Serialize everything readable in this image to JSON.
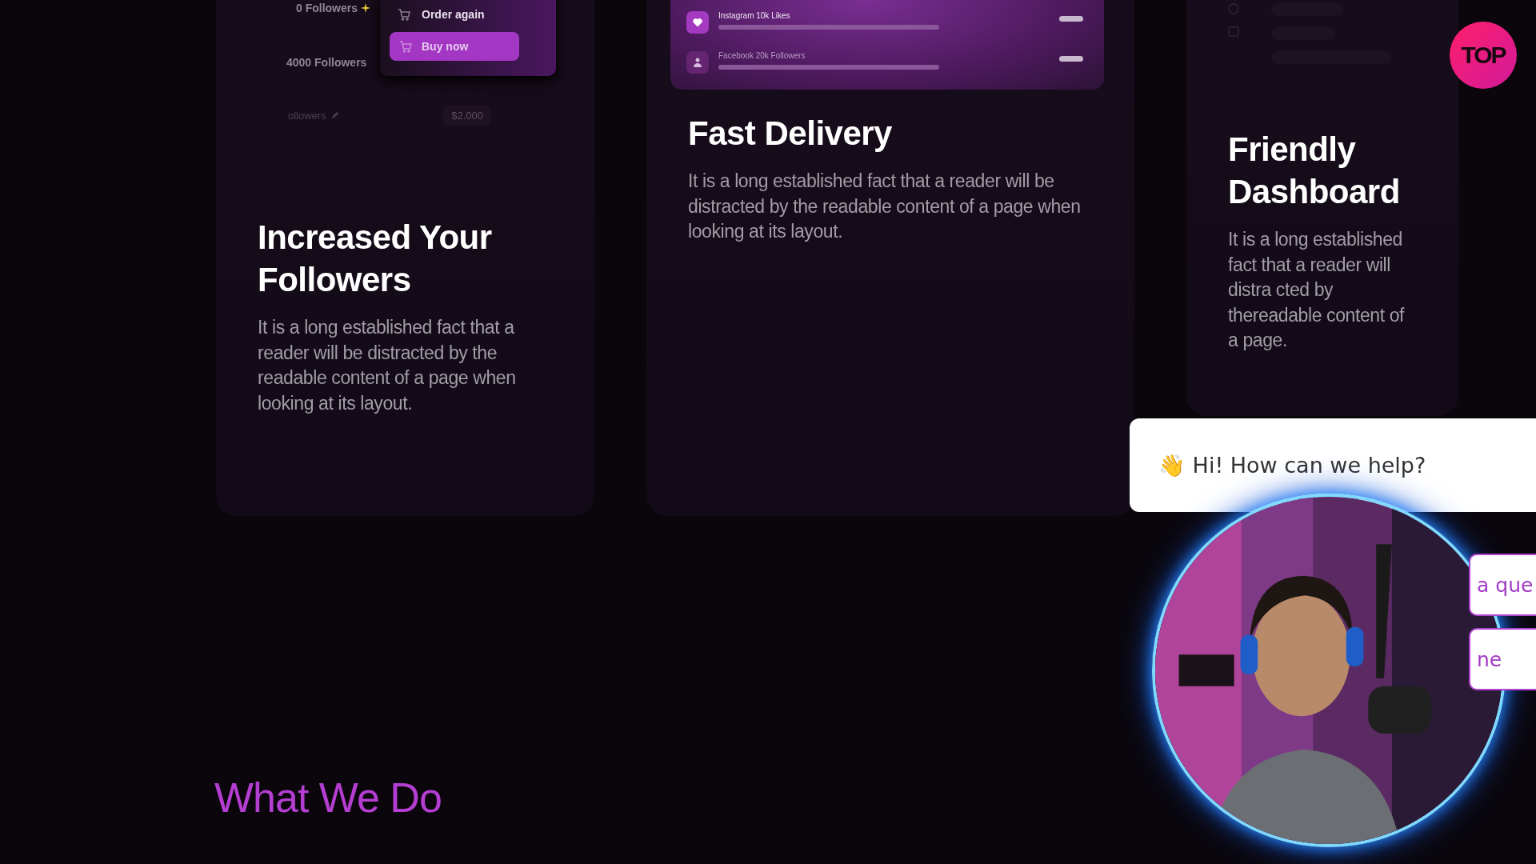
{
  "logo": {
    "text": "TOP"
  },
  "cards": [
    {
      "kind": "orders",
      "title": "Increased Your Followers",
      "body": "It is a long established fact that a reader will be distracted by the readable content of a page when looking at its layout.",
      "mockup": {
        "rows": [
          "0 Followers",
          "4000 Followers"
        ],
        "last_row": {
          "label": "ollowers",
          "price": "$2.000"
        },
        "menu": {
          "item": "Order again",
          "button": "Buy now"
        }
      }
    },
    {
      "kind": "services",
      "title": "Fast Delivery",
      "body": "It is a long established fact that a reader will be distracted by the readable content of a page when looking at its layout.",
      "mockup": {
        "items": [
          {
            "label": "Instagram 10k Likes",
            "level": 1
          },
          {
            "label": "Facebook 20k Followers",
            "level": 1
          }
        ]
      }
    },
    {
      "kind": "dashboard",
      "title": "Friendly Dashboard",
      "body": "It is a long established fact that a reader will distra cted by thereadable content of a page."
    }
  ],
  "section_heading": "What We Do",
  "chat": {
    "greeting": "👋 Hi! How can we help?",
    "options": [
      "a que",
      "ne"
    ]
  }
}
